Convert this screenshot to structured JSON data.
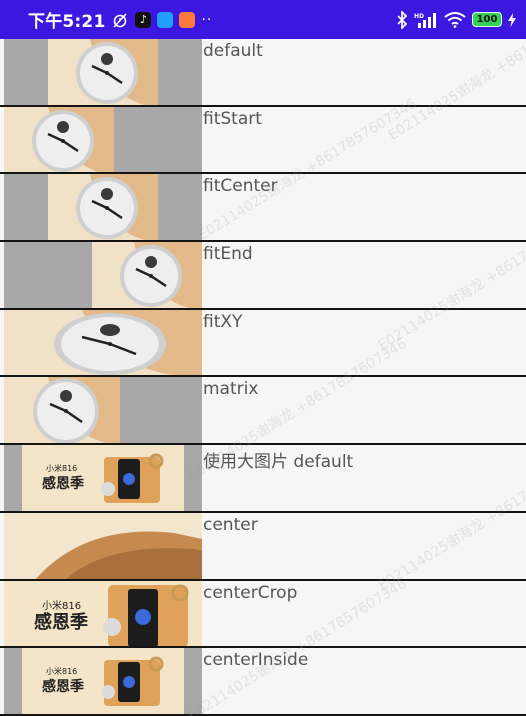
{
  "status_bar": {
    "time": "下午5:21",
    "dots": "··",
    "battery": "100"
  },
  "rows": [
    {
      "label": "default"
    },
    {
      "label": "fitStart"
    },
    {
      "label": "fitCenter"
    },
    {
      "label": "fitEnd"
    },
    {
      "label": "fitXY"
    },
    {
      "label": "matrix"
    },
    {
      "label": "使用大图片 default"
    },
    {
      "label": "center"
    },
    {
      "label": "centerCrop"
    },
    {
      "label": "centerInside"
    }
  ],
  "banner": {
    "brand": "小米816",
    "title": "感恩季"
  },
  "watermark": {
    "text": "E02114025谢海龙 +8617857607346"
  },
  "colors": {
    "status_bar": "#3b17e0",
    "image_letterbox": "#a8a8a8",
    "row_divider": "#141414",
    "label_text": "#555555"
  }
}
